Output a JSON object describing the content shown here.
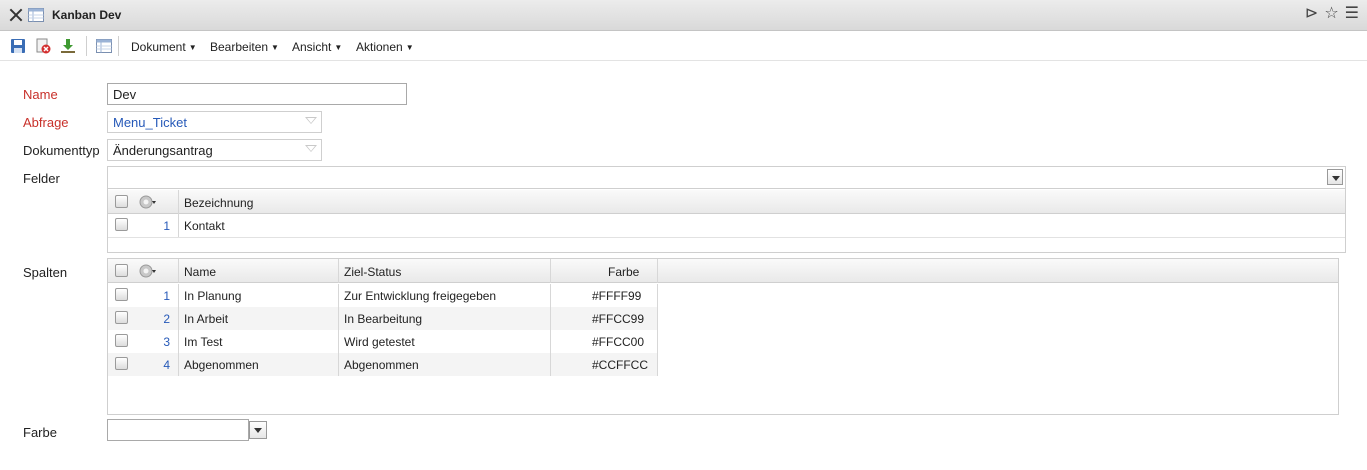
{
  "window": {
    "title": "Kanban Dev"
  },
  "toolbar": {
    "menus": [
      {
        "label": "Dokument"
      },
      {
        "label": "Bearbeiten"
      },
      {
        "label": "Ansicht"
      },
      {
        "label": "Aktionen"
      }
    ]
  },
  "form": {
    "name_label": "Name",
    "name_value": "Dev",
    "abfrage_label": "Abfrage",
    "abfrage_value": "Menu_Ticket",
    "dokumenttyp_label": "Dokumenttyp",
    "dokumenttyp_value": "Änderungsantrag",
    "felder_label": "Felder",
    "spalten_label": "Spalten",
    "farbe_label": "Farbe",
    "farbe_value": ""
  },
  "felder_grid": {
    "columns": [
      "Bezeichnung"
    ],
    "rows": [
      {
        "num": "1",
        "bezeichnung": "Kontakt"
      }
    ]
  },
  "spalten_grid": {
    "columns": [
      "Name",
      "Ziel-Status",
      "Farbe"
    ],
    "rows": [
      {
        "num": "1",
        "name": "In Planung",
        "ziel": "Zur Entwicklung freigegeben",
        "farbe": "#FFFF99"
      },
      {
        "num": "2",
        "name": "In Arbeit",
        "ziel": "In Bearbeitung",
        "farbe": "#FFCC99"
      },
      {
        "num": "3",
        "name": "Im Test",
        "ziel": "Wird getestet",
        "farbe": "#FFCC00"
      },
      {
        "num": "4",
        "name": "Abgenommen",
        "ziel": "Abgenommen",
        "farbe": "#CCFFCC"
      }
    ]
  },
  "colors": {
    "required_label": "#c8302a",
    "link": "#2659b8"
  }
}
